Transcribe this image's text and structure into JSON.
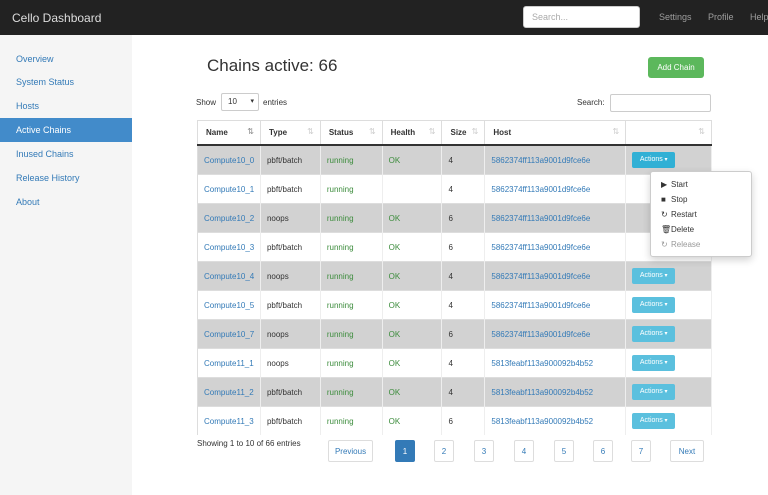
{
  "app": {
    "brand": "Cello Dashboard"
  },
  "topnav": {
    "search_placeholder": "Search...",
    "links": [
      "Settings",
      "Profile",
      "Help"
    ]
  },
  "sidebar": {
    "items": [
      "Overview",
      "System Status",
      "Hosts",
      "Active Chains",
      "Inused Chains",
      "Release History",
      "About"
    ],
    "active": "Active Chains"
  },
  "main": {
    "title": "Chains active: 66",
    "add_button": "Add Chain"
  },
  "table_controls": {
    "show_label": "Show",
    "page_length": "10",
    "entries_label": "entries",
    "search_label": "Search:"
  },
  "table": {
    "columns": [
      "Name",
      "Type",
      "Status",
      "Health",
      "Size",
      "Host",
      ""
    ],
    "rows": [
      {
        "name": "Compute10_0",
        "type": "pbft/batch",
        "status": "running",
        "health": "OK",
        "size": "4",
        "host": "5862374ff113a9001d9fce6e",
        "action": "Actions"
      },
      {
        "name": "Compute10_1",
        "type": "pbft/batch",
        "status": "running",
        "health": "",
        "size": "4",
        "host": "5862374ff113a9001d9fce6e",
        "action": ""
      },
      {
        "name": "Compute10_2",
        "type": "noops",
        "status": "running",
        "health": "OK",
        "size": "6",
        "host": "5862374ff113a9001d9fce6e",
        "action": ""
      },
      {
        "name": "Compute10_3",
        "type": "pbft/batch",
        "status": "running",
        "health": "OK",
        "size": "6",
        "host": "5862374ff113a9001d9fce6e",
        "action": ""
      },
      {
        "name": "Compute10_4",
        "type": "noops",
        "status": "running",
        "health": "OK",
        "size": "4",
        "host": "5862374ff113a9001d9fce6e",
        "action": "Actions"
      },
      {
        "name": "Compute10_5",
        "type": "pbft/batch",
        "status": "running",
        "health": "OK",
        "size": "4",
        "host": "5862374ff113a9001d9fce6e",
        "action": "Actions"
      },
      {
        "name": "Compute10_7",
        "type": "noops",
        "status": "running",
        "health": "OK",
        "size": "6",
        "host": "5862374ff113a9001d9fce6e",
        "action": "Actions"
      },
      {
        "name": "Compute11_1",
        "type": "noops",
        "status": "running",
        "health": "OK",
        "size": "4",
        "host": "5813feabf113a900092b4b52",
        "action": "Actions"
      },
      {
        "name": "Compute11_2",
        "type": "pbft/batch",
        "status": "running",
        "health": "OK",
        "size": "4",
        "host": "5813feabf113a900092b4b52",
        "action": "Actions"
      },
      {
        "name": "Compute11_3",
        "type": "pbft/batch",
        "status": "running",
        "health": "OK",
        "size": "6",
        "host": "5813feabf113a900092b4b52",
        "action": "Actions"
      }
    ]
  },
  "dropdown": {
    "items": [
      {
        "label": "Start",
        "icon": "play-icon",
        "glyph": "▶",
        "disabled": false
      },
      {
        "label": "Stop",
        "icon": "stop-icon",
        "glyph": "■",
        "disabled": false
      },
      {
        "label": "Restart",
        "icon": "refresh-icon",
        "glyph": "↻",
        "disabled": false
      },
      {
        "label": "Delete",
        "icon": "trash-icon",
        "glyph": "🗑",
        "disabled": false
      },
      {
        "label": "Release",
        "icon": "refresh-icon",
        "glyph": "↻",
        "disabled": true
      }
    ]
  },
  "pagination": {
    "info": "Showing 1 to 10 of 66 entries",
    "previous": "Previous",
    "pages": [
      "1",
      "2",
      "3",
      "4",
      "5",
      "6",
      "7"
    ],
    "current": "1",
    "next": "Next"
  },
  "colors": {
    "topbar": "#222222",
    "sidebar_active": "#428bca",
    "add_button": "#5cb85c",
    "actions_button": "#5bc0de",
    "link": "#337ab7",
    "running": "#3c8c3c",
    "row_stripe": "#d2d2d2"
  }
}
